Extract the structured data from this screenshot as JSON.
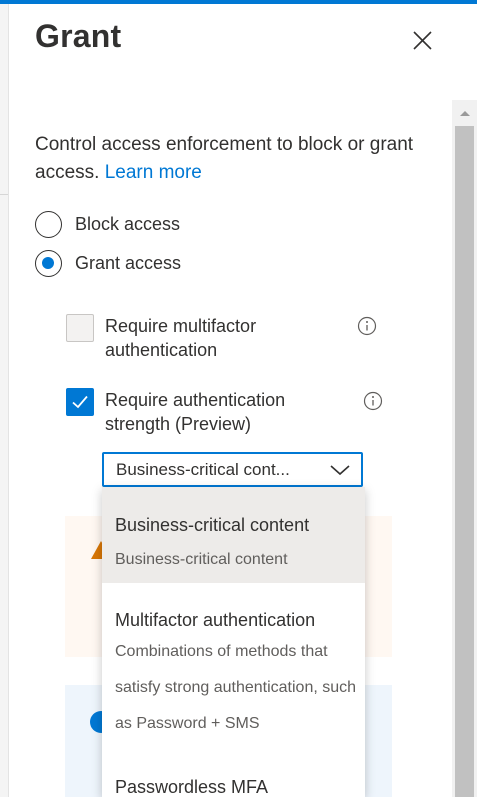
{
  "panel": {
    "title": "Grant",
    "description": "Control access enforcement to block or grant access.",
    "learn_more": "Learn more"
  },
  "access_options": [
    {
      "label": "Block access",
      "selected": false
    },
    {
      "label": "Grant access",
      "selected": true
    }
  ],
  "controls": [
    {
      "label": "Require multifactor authentication",
      "checked": false
    },
    {
      "label": "Require authentication strength (Preview)",
      "checked": true
    }
  ],
  "strength_dropdown": {
    "value": "Business-critical cont...",
    "options": [
      {
        "title": "Business-critical content",
        "description": "Business-critical content",
        "selected": true
      },
      {
        "title": "Multifactor authentication",
        "description": "Combinations of methods that satisfy strong authentication, such as Password + SMS",
        "selected": false
      },
      {
        "title": "Passwordless MFA",
        "description": "",
        "selected": false
      }
    ]
  },
  "colors": {
    "accent": "#0078d4",
    "warning_bg": "#fff8f2",
    "warning_icon": "#d97706",
    "info_bg": "#eef5fc",
    "selected_option_bg": "#edebe9"
  },
  "icons": {
    "close": "close-icon",
    "info": "info-icon",
    "chevron": "chevron-down-icon",
    "warning": "warning-icon",
    "check": "checkmark-icon"
  }
}
